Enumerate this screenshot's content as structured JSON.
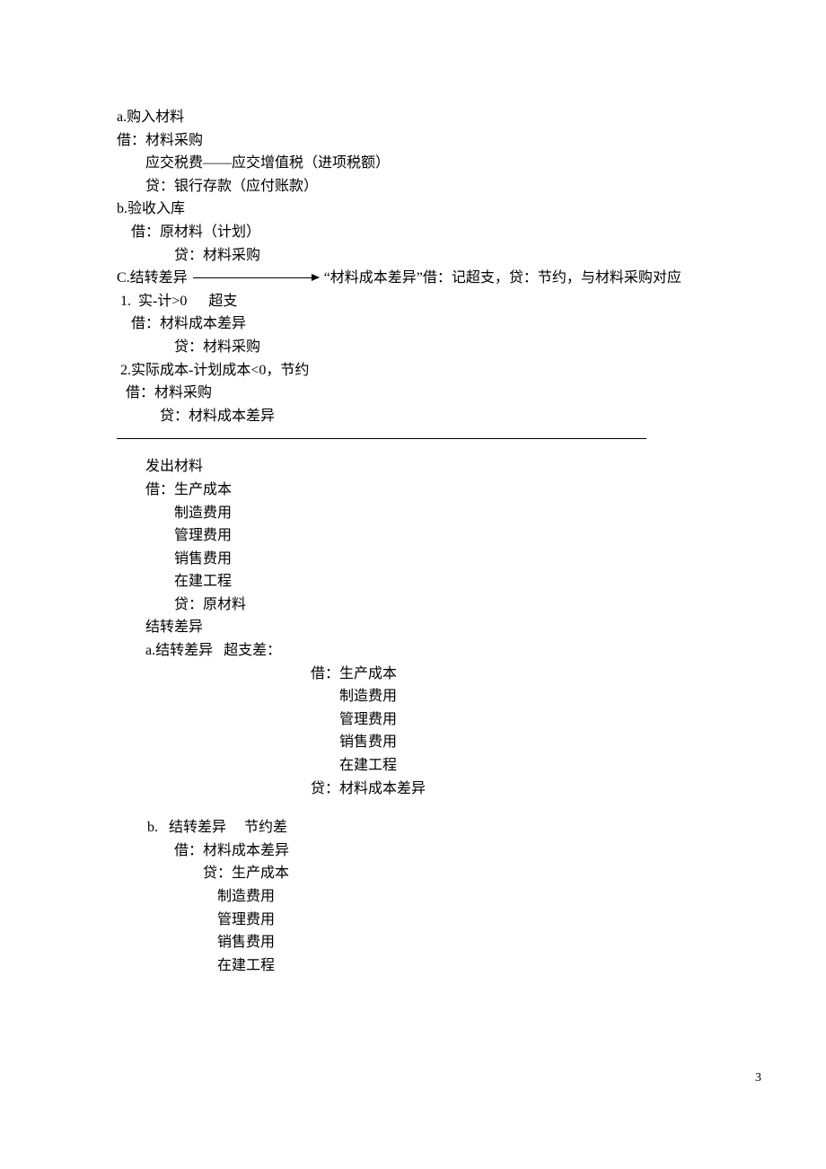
{
  "section_a": {
    "title": "a.购入材料",
    "l1": "借：材料采购",
    "l2": "应交税费——应交增值税（进项税额）",
    "l3": "贷：银行存款（应付账款）"
  },
  "section_b": {
    "title": "b.验收入库",
    "l1": "借：原材料（计划）",
    "l2": "贷：材料采购"
  },
  "section_c": {
    "title": "C.结转差异",
    "note": "“材料成本差异”借：记超支，贷：节约，与材料采购对应",
    "sub1": {
      "head": " 1.  实-计>0      超支",
      "l1": "借：材料成本差异",
      "l2": "贷：材料采购"
    },
    "sub2": {
      "head": " 2.实际成本-计划成本<0，节约",
      "l1": "借：材料采购",
      "l2": "贷：材料成本差异"
    }
  },
  "issue": {
    "title": "发出材料",
    "l1": "借：生产成本",
    "l2": "制造费用",
    "l3": "管理费用",
    "l4": "销售费用",
    "l5": "在建工程",
    "l6": "贷：原材料"
  },
  "transfer": {
    "title": "结转差异",
    "a": {
      "head": "a.结转差异   超支差：",
      "l1": "借：生产成本",
      "l2": "制造费用",
      "l3": "管理费用",
      "l4": "销售费用",
      "l5": "在建工程",
      "l6": "贷：材料成本差异"
    },
    "b": {
      "head": "b.   结转差异     节约差",
      "l1": "借：材料成本差异",
      "l2": "贷：生产成本",
      "l3": "制造费用",
      "l4": "管理费用",
      "l5": "销售费用",
      "l6": "在建工程"
    }
  },
  "page_number": "3"
}
